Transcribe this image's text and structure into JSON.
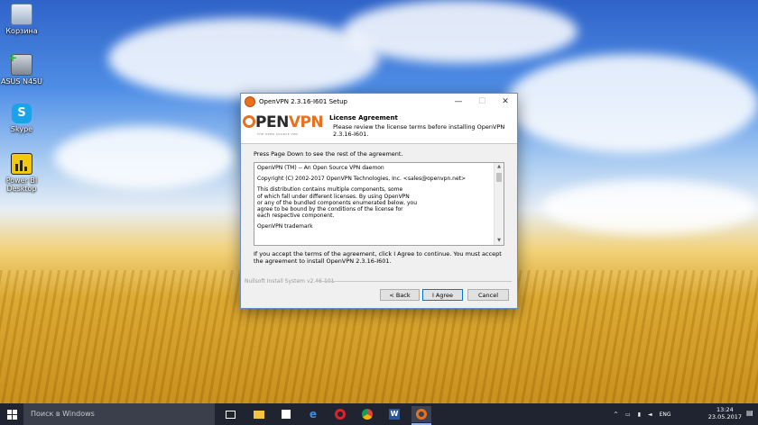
{
  "desktop": {
    "icons": [
      {
        "label": "Корзина",
        "icon": "recycle-bin-icon"
      },
      {
        "label": "ASUS N45U",
        "icon": "computer-icon"
      },
      {
        "label": "Skype",
        "icon": "skype-icon"
      },
      {
        "label": "Power BI Desktop",
        "icon": "power-bi-icon"
      }
    ]
  },
  "dialog": {
    "title": "OpenVPN 2.3.16-I601 Setup",
    "logo_text": {
      "o": "O",
      "pen": "PEN",
      "vpn": "VPN"
    },
    "logo_tagline": "THE OPEN SOURCE VPN",
    "header_title": "License Agreement",
    "header_subtitle": "Please review the license terms before installing OpenVPN 2.3.16-I601.",
    "hint": "Press Page Down to see the rest of the agreement.",
    "license_lines": [
      "OpenVPN (TM) -- An Open Source VPN daemon",
      "Copyright (C) 2002-2017 OpenVPN Technologies, Inc. <sales@openvpn.net>",
      "This distribution contains multiple components, some\nof which fall under different licenses.  By using OpenVPN\nor any of the bundled components enumerated below, you\nagree to be bound by the conditions of the license for\neach respective component.",
      "OpenVPN trademark"
    ],
    "accept_text": "If you accept the terms of the agreement, click I Agree to continue. You must accept the agreement to install OpenVPN 2.3.16-I601.",
    "nsis_label": "Nullsoft Install System v2.46-101",
    "buttons": {
      "back": "< Back",
      "agree": "I Agree",
      "cancel": "Cancel"
    },
    "controls": {
      "minimize": "—",
      "maximize": "☐",
      "close": "✕"
    }
  },
  "taskbar": {
    "search_placeholder": "Поиск в Windows",
    "apps": [
      "task-view-icon",
      "file-explorer-icon",
      "store-icon",
      "edge-icon",
      "opera-icon",
      "chrome-icon",
      "word-icon",
      "openvpn-icon"
    ],
    "language": "ENG",
    "time": "13:24",
    "date": "23.05.2017"
  },
  "colors": {
    "accent": "#e8701e",
    "taskbar": "#1f2430",
    "dialog": "#f0f0f0"
  }
}
